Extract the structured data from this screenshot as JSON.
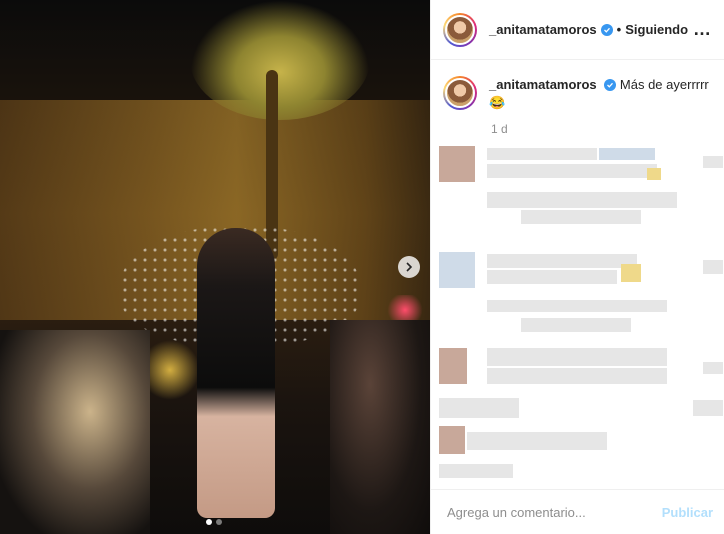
{
  "post": {
    "username": "_anitamatamoros",
    "separator": "•",
    "follow_status": "Siguiendo",
    "more_icon": "…",
    "caption_user": "_anitamatamoros",
    "caption_text": "Más de ayerrrrr",
    "caption_emoji": "😂",
    "time_ago": "1 d"
  },
  "media": {
    "next_icon": "chevron-right-icon",
    "slide_count": 2,
    "active_slide": 1
  },
  "footer": {
    "placeholder": "Agrega un comentario...",
    "post_label": "Publicar"
  },
  "colors": {
    "verified": "#3897f0",
    "publish_disabled": "#b2dffc"
  }
}
